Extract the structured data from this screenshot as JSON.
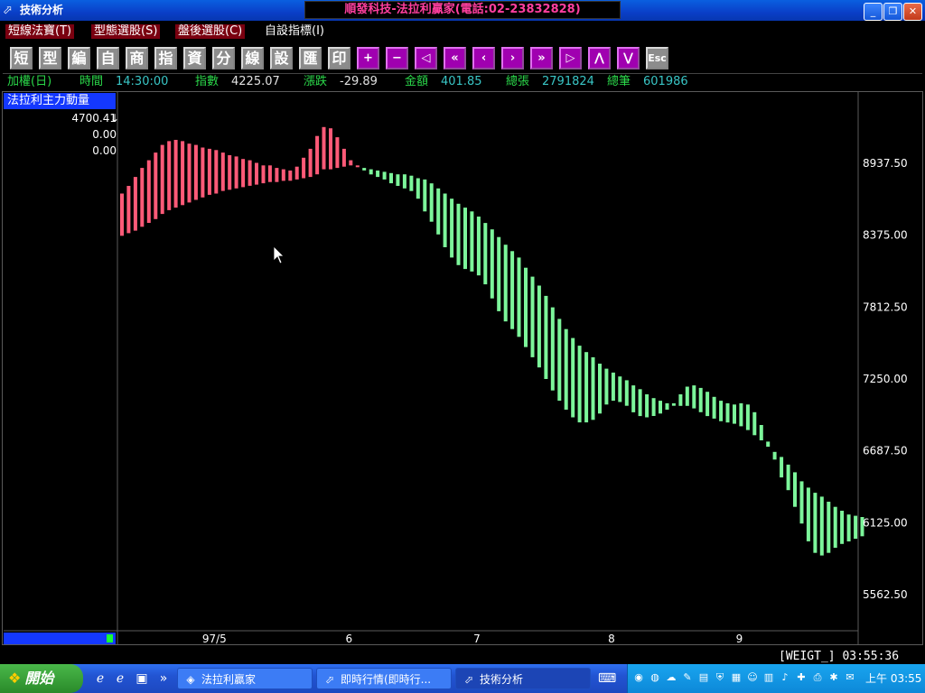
{
  "window": {
    "title": "技術分析",
    "banner": "順發科技-法拉利贏家(電話:02-23832828)",
    "minimize": "_",
    "restore": "❐",
    "close": "✕"
  },
  "menu": [
    {
      "label": "短線法寶(T)"
    },
    {
      "label": "型態選股(S)"
    },
    {
      "label": "盤後選股(C)"
    },
    {
      "label": "自設指標(I)"
    }
  ],
  "toolbar": {
    "buttons": [
      "短",
      "型",
      "編",
      "自",
      "商",
      "指",
      "資",
      "分",
      "線",
      "設",
      "匯",
      "印"
    ],
    "nav": [
      "+",
      "−",
      "◁",
      "«",
      "‹",
      "›",
      "»",
      "▷",
      "⋀",
      "⋁"
    ],
    "esc": "Esc"
  },
  "quote": {
    "name_label": "加權(日)",
    "time_label": "時間",
    "time_value": "14:30:00",
    "index_label": "指數",
    "index_value": "4225.07",
    "change_label": "漲跌",
    "change_value": "-29.89",
    "amount_label": "金額",
    "amount_value": "401.85",
    "volume_label": "總張",
    "volume_value": "2791824",
    "trades_label": "總筆",
    "trades_value": "601986"
  },
  "indicator": {
    "name": "法拉利主力動量",
    "values": [
      "4700.41",
      "0.00",
      "0.00"
    ],
    "arrow": "↓"
  },
  "status": "[WEIGT_]  03:55:36",
  "taskbar": {
    "start": "開始",
    "tasks": [
      "法拉利贏家",
      "即時行情(即時行...",
      "技術分析"
    ],
    "clock": "上午 03:55"
  },
  "colors": {
    "up": "#ff5a78",
    "down": "#7cf59a",
    "accent": "#1438ff"
  },
  "chart_data": {
    "type": "bar",
    "x_ticks": [
      "97/5",
      "6",
      "7",
      "8",
      "9"
    ],
    "x_tick_index": [
      14,
      34,
      53,
      73,
      92
    ],
    "y_ticks": [
      8937.5,
      8375.0,
      7812.5,
      7250.0,
      6687.5,
      6125.0,
      5562.5
    ],
    "ylim": [
      5281.25,
      9493.75
    ],
    "series": [
      {
        "name": "up",
        "color": "#ff5a78",
        "bars": [
          [
            8700,
            8370
          ],
          [
            8760,
            8390
          ],
          [
            8830,
            8410
          ],
          [
            8900,
            8440
          ],
          [
            8960,
            8470
          ],
          [
            9020,
            8500
          ],
          [
            9080,
            8540
          ],
          [
            9110,
            8570
          ],
          [
            9120,
            8590
          ],
          [
            9110,
            8610
          ],
          [
            9090,
            8630
          ],
          [
            9080,
            8650
          ],
          [
            9060,
            8670
          ],
          [
            9050,
            8690
          ],
          [
            9040,
            8700
          ],
          [
            9020,
            8720
          ],
          [
            9000,
            8730
          ],
          [
            8990,
            8740
          ],
          [
            8970,
            8750
          ],
          [
            8960,
            8760
          ],
          [
            8940,
            8770
          ],
          [
            8920,
            8780
          ],
          [
            8920,
            8790
          ],
          [
            8900,
            8790
          ],
          [
            8890,
            8800
          ],
          [
            8880,
            8800
          ],
          [
            8910,
            8810
          ],
          [
            8980,
            8820
          ],
          [
            9050,
            8830
          ],
          [
            9150,
            8850
          ],
          [
            9220,
            8890
          ],
          [
            9210,
            8890
          ],
          [
            9140,
            8900
          ],
          [
            9050,
            8910
          ],
          [
            8960,
            8920
          ],
          [
            8920,
            8920
          ]
        ]
      },
      {
        "name": "down",
        "color": "#7cf59a",
        "bars": [
          [
            8900,
            8880
          ],
          [
            8890,
            8850
          ],
          [
            8880,
            8830
          ],
          [
            8870,
            8810
          ],
          [
            8860,
            8780
          ],
          [
            8850,
            8760
          ],
          [
            8850,
            8740
          ],
          [
            8840,
            8720
          ],
          [
            8820,
            8660
          ],
          [
            8810,
            8560
          ],
          [
            8780,
            8480
          ],
          [
            8740,
            8380
          ],
          [
            8700,
            8280
          ],
          [
            8660,
            8200
          ],
          [
            8620,
            8140
          ],
          [
            8590,
            8110
          ],
          [
            8560,
            8090
          ],
          [
            8520,
            8060
          ],
          [
            8470,
            7990
          ],
          [
            8420,
            7880
          ],
          [
            8360,
            7780
          ],
          [
            8300,
            7700
          ],
          [
            8250,
            7640
          ],
          [
            8200,
            7580
          ],
          [
            8120,
            7500
          ],
          [
            8050,
            7420
          ],
          [
            7980,
            7340
          ],
          [
            7900,
            7250
          ],
          [
            7810,
            7160
          ],
          [
            7720,
            7080
          ],
          [
            7640,
            7010
          ],
          [
            7570,
            6950
          ],
          [
            7510,
            6910
          ],
          [
            7460,
            6910
          ],
          [
            7420,
            6930
          ],
          [
            7370,
            6980
          ],
          [
            7330,
            7050
          ],
          [
            7300,
            7080
          ],
          [
            7270,
            7070
          ],
          [
            7240,
            7040
          ],
          [
            7200,
            6990
          ],
          [
            7170,
            6960
          ],
          [
            7130,
            6950
          ],
          [
            7100,
            6960
          ],
          [
            7080,
            6980
          ],
          [
            7060,
            7010
          ],
          [
            7040,
            7060
          ],
          [
            7040,
            7130
          ],
          [
            7040,
            7190
          ],
          [
            7020,
            7200
          ],
          [
            6990,
            7180
          ],
          [
            6960,
            7150
          ],
          [
            6940,
            7110
          ],
          [
            6920,
            7080
          ],
          [
            6910,
            7060
          ],
          [
            6900,
            7050
          ],
          [
            6880,
            7060
          ],
          [
            6850,
            7050
          ],
          [
            6810,
            6990
          ],
          [
            6770,
            6890
          ],
          [
            6720,
            6760
          ],
          [
            6680,
            6620
          ],
          [
            6640,
            6480
          ],
          [
            6580,
            6380
          ],
          [
            6520,
            6250
          ],
          [
            6450,
            6120
          ],
          [
            6400,
            5980
          ],
          [
            6360,
            5890
          ],
          [
            6330,
            5870
          ],
          [
            6290,
            5890
          ],
          [
            6250,
            5930
          ],
          [
            6220,
            5960
          ],
          [
            6190,
            5980
          ],
          [
            6180,
            6000
          ],
          [
            6170,
            6020
          ]
        ]
      }
    ]
  }
}
